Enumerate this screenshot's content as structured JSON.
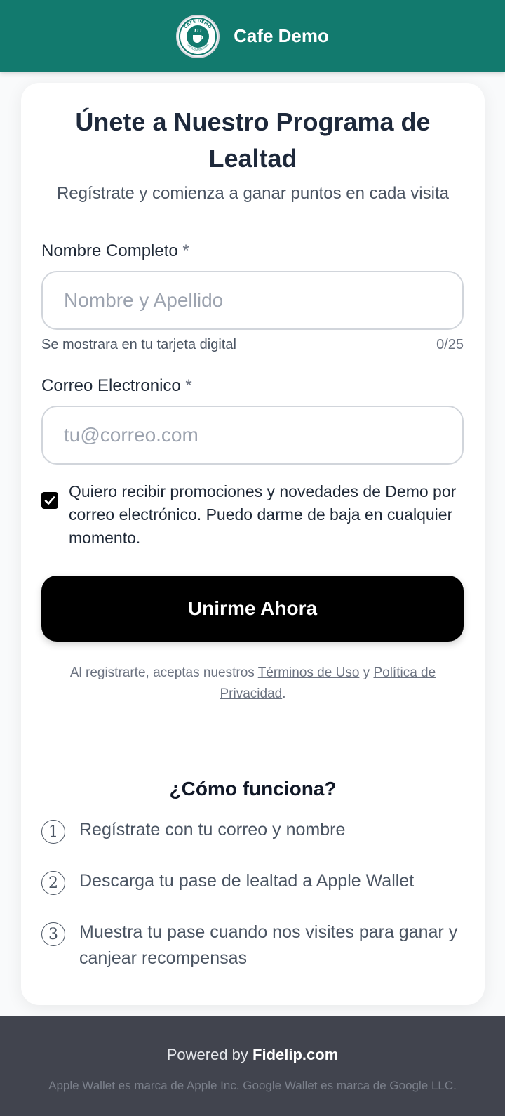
{
  "header": {
    "brand": "Cafe Demo",
    "logo_icon": "cafe-logo-icon",
    "logo_text_top": "CAFE DEMO",
    "logo_text_bottom": "CURTIDO ARTESANAL"
  },
  "signup": {
    "title": "Únete a Nuestro Programa de Lealtad",
    "subtitle": "Regístrate y comienza a ganar puntos en cada visita",
    "name": {
      "label": "Nombre Completo",
      "required_mark": "*",
      "placeholder": "Nombre y Apellido",
      "value": "",
      "helper": "Se mostrara en tu tarjeta digital",
      "counter": "0/25"
    },
    "email": {
      "label": "Correo Electronico",
      "required_mark": "*",
      "placeholder": "tu@correo.com",
      "value": ""
    },
    "consent": {
      "checked": true,
      "text": "Quiero recibir promociones y novedades de Demo por correo electrónico. Puedo darme de baja en cualquier momento."
    },
    "submit_label": "Unirme Ahora",
    "legal": {
      "prefix": "Al registrarte, aceptas nuestros ",
      "terms": "Términos de Uso",
      "conjunction": " y ",
      "privacy": "Política de Privacidad",
      "suffix": "."
    }
  },
  "how_it_works": {
    "title": "¿Cómo funciona?",
    "steps": [
      {
        "num": "1",
        "text": "Regístrate con tu correo y nombre"
      },
      {
        "num": "2",
        "text": "Descarga tu pase de lealtad a Apple Wallet"
      },
      {
        "num": "3",
        "text": "Muestra tu pase cuando nos visites para ganar y canjear recompensas"
      }
    ]
  },
  "footer": {
    "powered_prefix": "Powered by ",
    "powered_brand": "Fidelip.com",
    "trademark": "Apple Wallet es marca de Apple Inc. Google Wallet es marca de Google LLC."
  },
  "colors": {
    "header_bg": "#127a6e",
    "button_bg": "#000000",
    "footer_bg": "#41444e"
  }
}
